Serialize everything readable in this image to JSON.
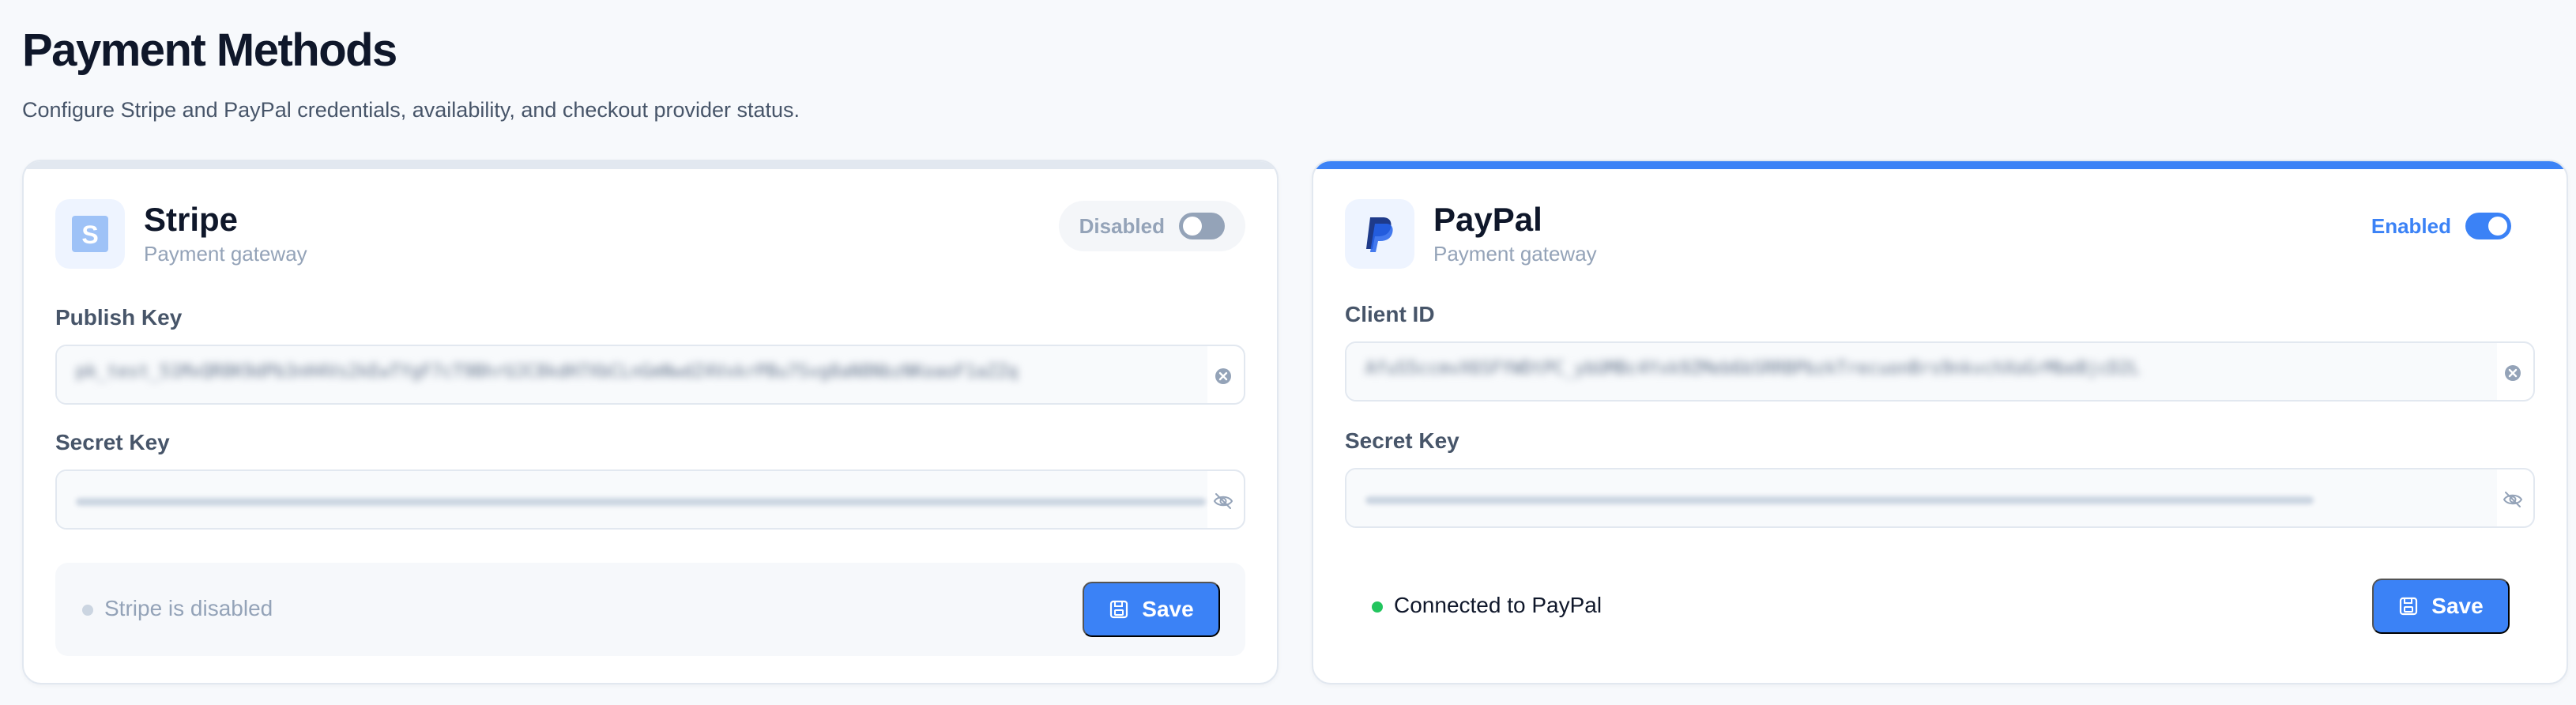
{
  "header": {
    "title": "Payment Methods",
    "subtitle": "Configure Stripe and PayPal credentials, availability, and checkout provider status."
  },
  "stripe": {
    "name": "Stripe",
    "subtitle": "Payment gateway",
    "logo_letter": "S",
    "toggle_label": "Disabled",
    "enabled": false,
    "field1_label": "Publish Key",
    "field1_value": "pk_test_51MxQR8K9dPb3nH4Vs2kEwTYgF7cT9BhrUJC8kdH7XbCLnGmNwdZ4VxkrPBu7Svg8aN8NbzNKoaoF1aZZq",
    "field1_icon": "clear-icon",
    "field2_label": "Secret Key",
    "field2_icon": "eye-off-icon",
    "status_text": "Stripe is disabled",
    "save_label": "Save",
    "accent": "#e2e8f0"
  },
  "paypal": {
    "name": "PayPal",
    "subtitle": "Payment gateway",
    "toggle_label": "Enabled",
    "enabled": true,
    "field1_label": "Client ID",
    "field1_value": "AfuS5ccmvX6SFYWDtPC_ybUMBc4Yxk9ZMeb6bSRRBPbzkTrecuonBrs9nkvchXoGrMbeBjcD2L",
    "field1_icon": "clear-icon",
    "field2_label": "Secret Key",
    "field2_icon": "eye-off-icon",
    "status_text": "Connected to PayPal",
    "save_label": "Save",
    "accent": "#3b82f6"
  },
  "colors": {
    "primary": "#3b82f6",
    "success": "#22c55e",
    "muted": "#94a3b8"
  }
}
